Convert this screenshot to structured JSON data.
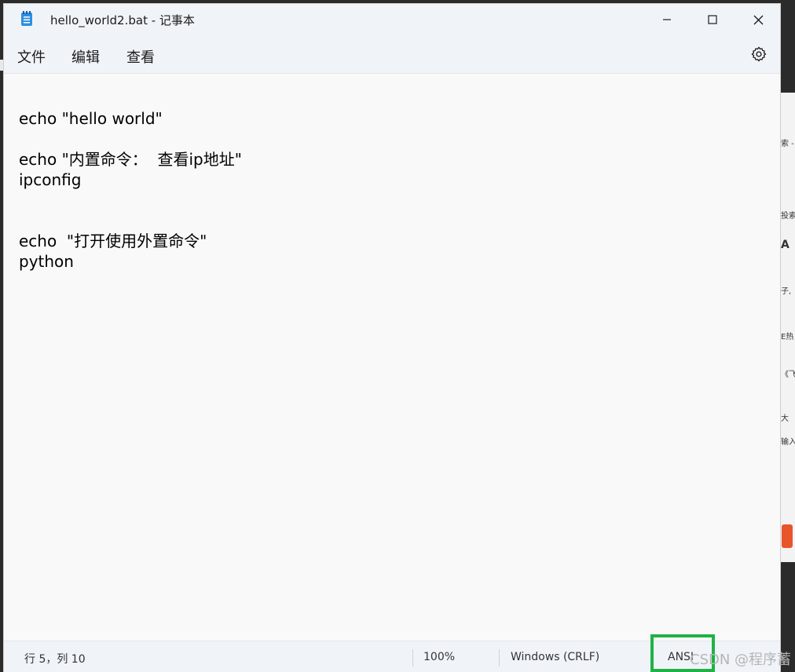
{
  "window": {
    "title": "hello_world2.bat - 记事本"
  },
  "menu": {
    "items": [
      {
        "label": "文件"
      },
      {
        "label": "编辑"
      },
      {
        "label": "查看"
      }
    ]
  },
  "editor": {
    "content": "echo \"hello world\"\n\necho \"内置命令：  查看ip地址\"\nipconfig\n\n\necho  \"打开使用外置命令\"\npython"
  },
  "status": {
    "position": "行 5，列 10",
    "zoom": "100%",
    "line_ending": "Windows (CRLF)",
    "encoding": "ANSI"
  },
  "watermark": "CSDN @程序蓄",
  "background_window": {
    "fragments": [
      "索 -",
      "投索",
      "A",
      "子,",
      "E热",
      "《飞",
      "大",
      "输入"
    ]
  },
  "icons": {
    "app": "notepad-icon",
    "minimize": "minimize-icon",
    "maximize": "maximize-icon",
    "close": "close-icon",
    "settings": "gear-icon"
  },
  "colors": {
    "chrome": "#f0f4f9",
    "editor_bg": "#f9f9f9",
    "app_icon": "#2f8fe0",
    "highlight": "#1fb245"
  }
}
